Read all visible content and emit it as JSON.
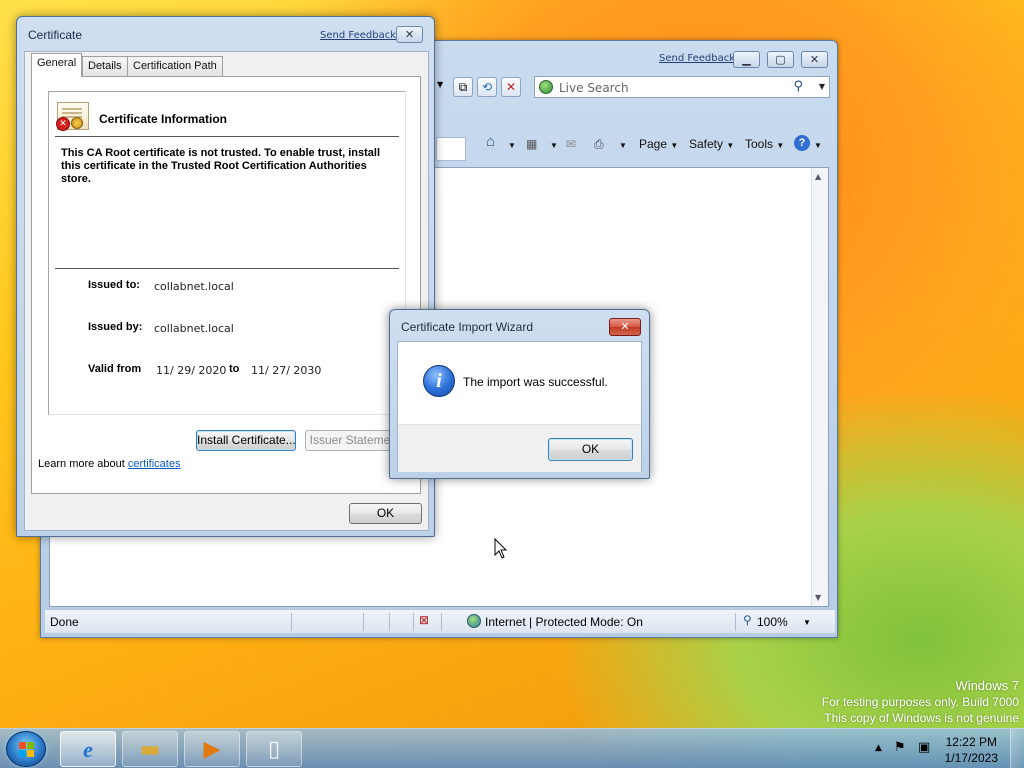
{
  "ie_window": {
    "send_feedback": "Send Feedback",
    "search_placeholder": "Live Search",
    "commands": {
      "page": "Page",
      "safety": "Safety",
      "tools": "Tools"
    },
    "status": {
      "done": "Done",
      "zone": "Internet | Protected Mode: On",
      "zoom": "100%"
    }
  },
  "cert_dialog": {
    "title": "Certificate",
    "send_feedback": "Send Feedback",
    "tabs": [
      "General",
      "Details",
      "Certification Path"
    ],
    "heading": "Certificate Information",
    "warning": "This CA Root certificate is not trusted. To enable trust, install this certificate in the Trusted Root Certification Authorities store.",
    "issued_to_label": "Issued to:",
    "issued_to": "collabnet.local",
    "issued_by_label": "Issued by:",
    "issued_by": "collabnet.local",
    "valid_from_label": "Valid from",
    "valid_from": "11/ 29/ 2020",
    "to_label": "to",
    "valid_to": "11/ 27/ 2030",
    "install_button": "Install Certificate...",
    "issuer_button": "Issuer Statement",
    "learn_more": "Learn more about",
    "learn_more_link": "certificates",
    "ok_button": "OK"
  },
  "wizard": {
    "title": "Certificate Import Wizard",
    "message": "The import was successful.",
    "ok_button": "OK"
  },
  "desktop": {
    "watermark_line1": "Windows 7",
    "watermark_line2": "For testing purposes only. Build 7000",
    "watermark_line3": "This copy of Windows is not genuine"
  },
  "taskbar": {
    "time": "12:22 PM",
    "date": "1/17/2023"
  }
}
